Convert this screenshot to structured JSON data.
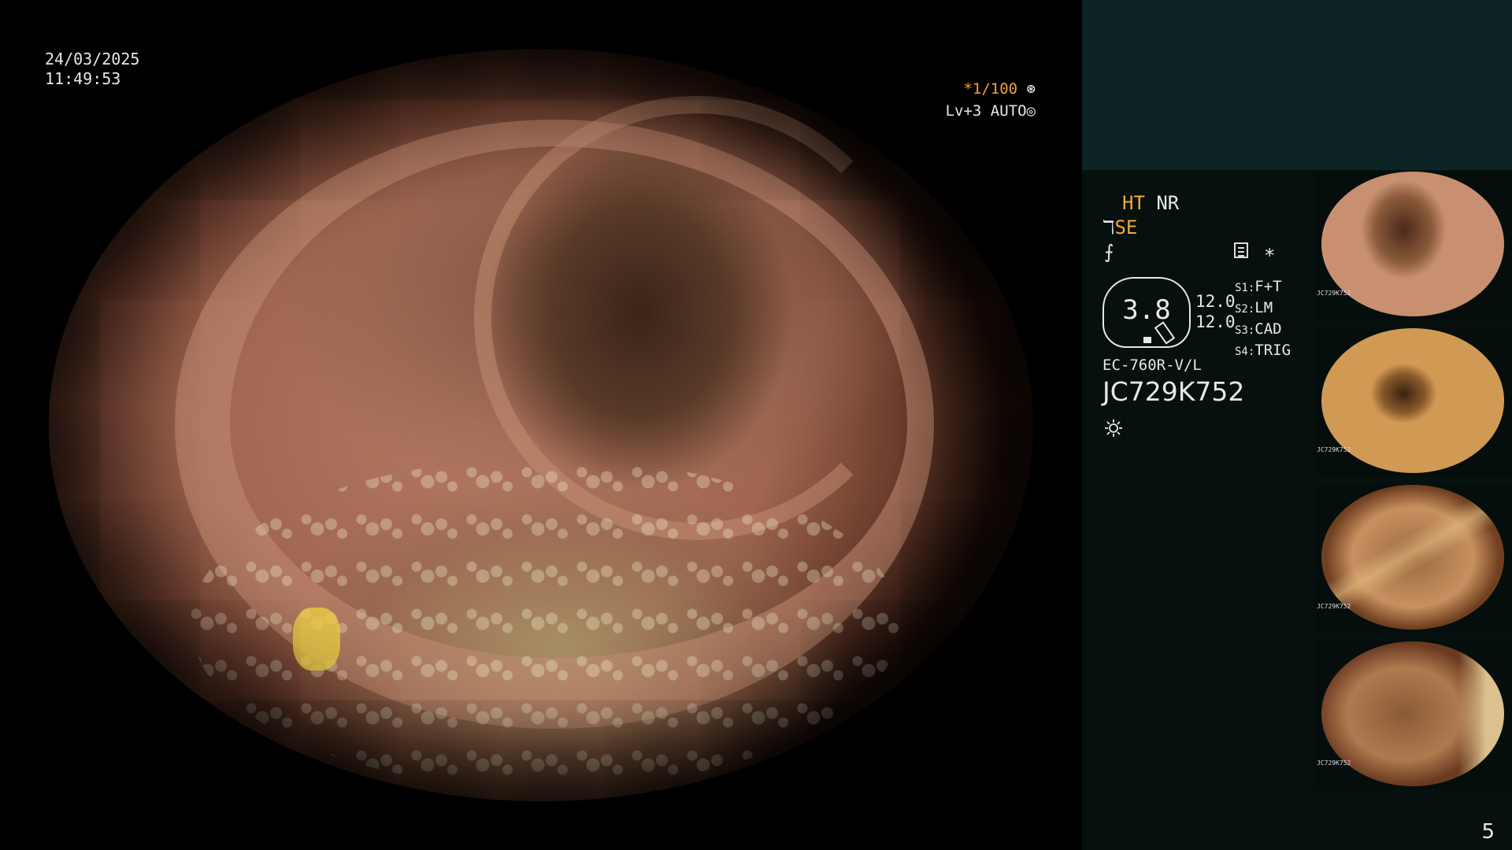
{
  "overlay": {
    "date": "24/03/2025",
    "time": "11:49:53",
    "shutter": "*1/100",
    "level": "Lv+3 AUTO"
  },
  "panel": {
    "ht": "HT",
    "nr": "NR",
    "se": "SE",
    "gauge_value": "3.8",
    "val1": "12.0",
    "val2": "12.0",
    "scopes": [
      {
        "key": "S1:",
        "value": "F+T"
      },
      {
        "key": "S2:",
        "value": "LM"
      },
      {
        "key": "S3:",
        "value": "CAD"
      },
      {
        "key": "S4:",
        "value": "TRIG"
      }
    ],
    "model": "EC-760R-V/L",
    "serial": "JC729K752"
  },
  "thumbnails": [
    {
      "label": "JC729K752"
    },
    {
      "label": "JC729K752"
    },
    {
      "label": "JC729K752"
    },
    {
      "label": "JC729K752"
    }
  ],
  "page_number": "5",
  "colors": {
    "accent": "#f2a934",
    "panel_bg": "#06100f",
    "panel_top_bg": "#0d2425"
  }
}
